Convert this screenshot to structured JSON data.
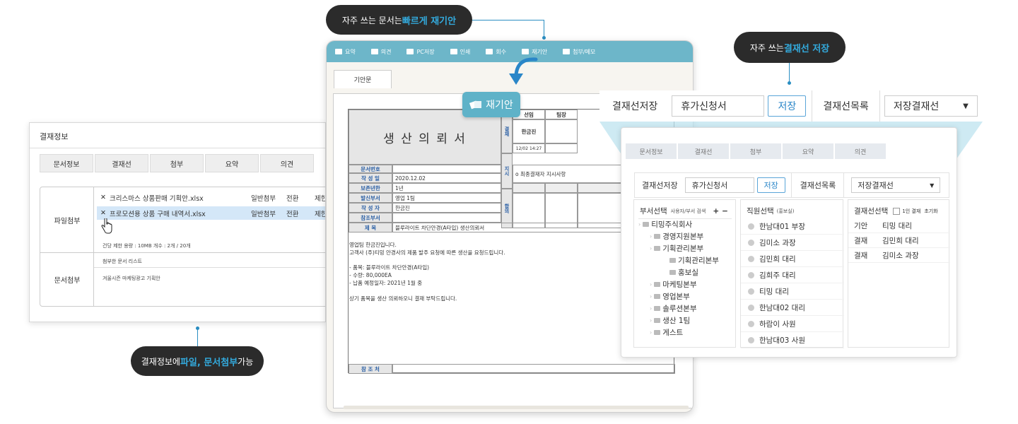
{
  "callouts": {
    "reissue": {
      "prefix": "자주 쓰는 문서는 ",
      "highlight": "빠르게 재기안"
    },
    "save": {
      "prefix": "자주 쓰는 ",
      "highlight": "결재선 저장"
    },
    "attach": {
      "prefix": "결재정보에 ",
      "highlight": "파일, 문서첨부",
      "suffix": " 가능"
    }
  },
  "left_panel": {
    "title": "결재정보",
    "tabs": [
      "문서정보",
      "결재선",
      "첨부",
      "요약",
      "의견"
    ],
    "file_attach_label": "파일첨부",
    "files": [
      {
        "name": "크리스마스 상품판매 기획안.xlsx",
        "type": "일반첨부",
        "convert": "전환",
        "extra": "제한"
      },
      {
        "name": "프로모션용 상품 구매 내역서.xlsx",
        "type": "일반첨부",
        "convert": "전환",
        "extra": "제한"
      }
    ],
    "capacity": "건당 제한 용량 : 10MB 개수 : 2개 / 20개",
    "doc_attach_label": "문서첨부",
    "doc_list_label": "첨부한 문서 리스트",
    "doc_item": "겨울시즌 마케팅광고 기획안"
  },
  "doc_window": {
    "toolbar": [
      "요약",
      "의견",
      "PC저장",
      "인쇄",
      "회수",
      "재기안",
      "첨부/메모"
    ],
    "tab": "기안문",
    "reissue_badge": "재기안",
    "form": {
      "title": "생 산 의 뢰 서",
      "approval_label": "결재",
      "col_heads": [
        "선임",
        "팀장"
      ],
      "approver": "한금진",
      "approve_time": "12/02 14:27",
      "directive_label": "지시",
      "directive": "o 최종결재자 지시사항",
      "agreement_label": "합의",
      "rows": [
        {
          "label": "문서번호",
          "value": ""
        },
        {
          "label": "작 성 일",
          "value": "2020.12.02"
        },
        {
          "label": "보존년한",
          "value": "1년"
        },
        {
          "label": "발신부서",
          "value": "영업 1팀"
        },
        {
          "label": "작 성 자",
          "value": "한금진"
        },
        {
          "label": "참조부서",
          "value": ""
        }
      ],
      "subject_label": "제    목",
      "subject": "블루라이트 차단안경(A타입) 생산의뢰서",
      "body": [
        "영업팀 한금진입니다.",
        "고객사 (주)티밍 안경사의 제품 발주 요청에 따른 생산을 요청드립니다.",
        "",
        "- 품목: 블루라이트 차단안경(A타입)",
        "- 수량: 80,000EA",
        "- 납품 예정일자: 2021년 1월 중",
        "",
        "상기 품목을 생산 의뢰하오니 결재 부탁드립니다."
      ],
      "ref_label": "참 조 처"
    }
  },
  "save_bar": {
    "save_label": "결재선저장",
    "input_value": "휴가신청서",
    "save_button": "저장",
    "list_label": "결재선목록",
    "select_value": "저장결재선"
  },
  "approval_panel": {
    "tabs": [
      "문서정보",
      "결재선",
      "첨부",
      "요약",
      "의견"
    ],
    "save_label": "결재선저장",
    "input_value": "휴가신청서",
    "save_button": "저장",
    "list_label": "결재선목록",
    "select_value": "저장결재선",
    "dept": {
      "title": "부서선택",
      "search": "사용자/부서 검색",
      "tree": [
        {
          "name": "티밍주식회사",
          "level": 0
        },
        {
          "name": "경영지원본부",
          "level": 1
        },
        {
          "name": "기획관리본부",
          "level": 1
        },
        {
          "name": "기획관리본부",
          "level": 2
        },
        {
          "name": "홍보실",
          "level": 2
        },
        {
          "name": "마케팅본부",
          "level": 1
        },
        {
          "name": "영업본부",
          "level": 1
        },
        {
          "name": "솔루션본부",
          "level": 1
        },
        {
          "name": "생산 1팀",
          "level": 1
        },
        {
          "name": "게스트",
          "level": 1
        }
      ]
    },
    "staff": {
      "title": "직원선택",
      "dept": "(홍보실)",
      "list": [
        "한남대01 부장",
        "김미소 과장",
        "김민희 대리",
        "김희주 대리",
        "티밍 대리",
        "한남대02 대리",
        "하람이 사원",
        "한남대03 사원"
      ]
    },
    "line": {
      "title": "결재선선택",
      "single": "1인 결재",
      "reset": "초기화",
      "rows": [
        {
          "role": "기안",
          "name": "티밍 대리"
        },
        {
          "role": "결재",
          "name": "김민희 대리"
        },
        {
          "role": "결재",
          "name": "김미소 과장"
        }
      ]
    }
  }
}
